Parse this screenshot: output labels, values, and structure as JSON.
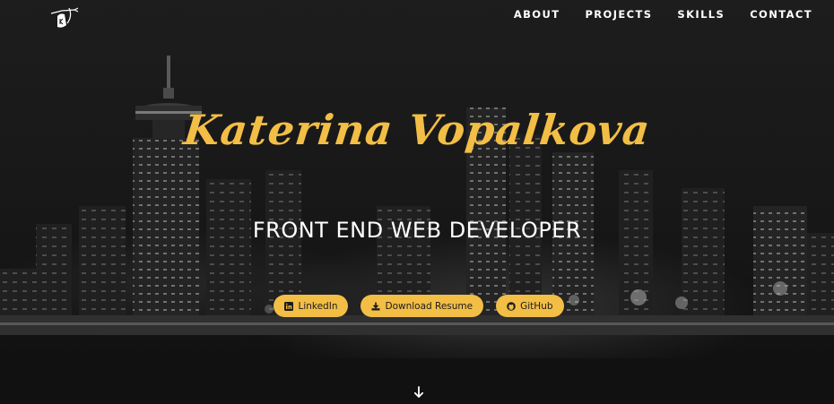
{
  "nav": {
    "logo_icon": "archer-k-logo-icon",
    "links": [
      {
        "label": "ABOUT"
      },
      {
        "label": "PROJECTS"
      },
      {
        "label": "SKILLS"
      },
      {
        "label": "CONTACT"
      }
    ]
  },
  "hero": {
    "name": "Katerina Vopalkova",
    "title": "FRONT END WEB DEVELOPER",
    "background_icon": "city-skyline-night-photo"
  },
  "buttons": {
    "linkedin": {
      "label": "LinkedIn",
      "icon": "linkedin-icon"
    },
    "resume": {
      "label": "Download Resume",
      "icon": "download-icon"
    },
    "github": {
      "label": "GitHub",
      "icon": "github-icon"
    }
  },
  "scroll": {
    "icon": "arrow-down-icon"
  },
  "colors": {
    "accent": "#f2be45",
    "background": "#141414",
    "nav_text": "#ffffff",
    "button_text": "#1b1b1b"
  }
}
